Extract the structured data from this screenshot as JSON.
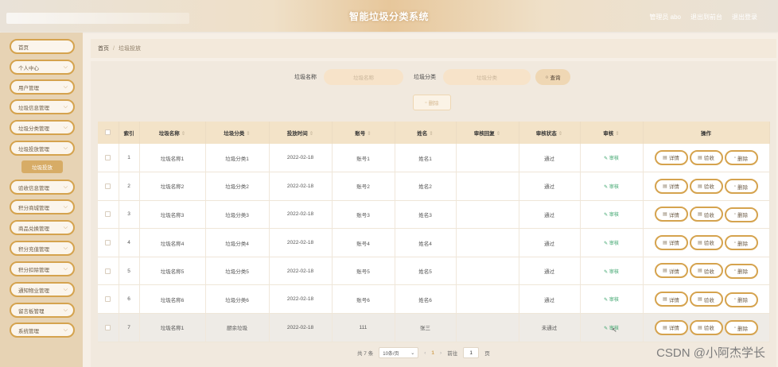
{
  "header": {
    "title": "智能垃圾分类系统",
    "admin_text": "管理员 abo",
    "back_label": "退出到前台",
    "logout_label": "退出登录"
  },
  "sidebar": {
    "items": [
      {
        "label": "首页",
        "has_chevron": false
      },
      {
        "label": "个人中心",
        "has_chevron": true
      },
      {
        "label": "用户管理",
        "has_chevron": true
      },
      {
        "label": "垃圾信息管理",
        "has_chevron": true
      },
      {
        "label": "垃圾分类管理",
        "has_chevron": true
      },
      {
        "label": "垃圾投放管理",
        "has_chevron": true
      },
      {
        "label": "验收信息管理",
        "has_chevron": true
      },
      {
        "label": "积分商城管理",
        "has_chevron": true
      },
      {
        "label": "商品兑换管理",
        "has_chevron": true
      },
      {
        "label": "积分充值管理",
        "has_chevron": true
      },
      {
        "label": "积分扣除管理",
        "has_chevron": true
      },
      {
        "label": "通知物业管理",
        "has_chevron": true
      },
      {
        "label": "留言板管理",
        "has_chevron": true
      },
      {
        "label": "系统管理",
        "has_chevron": true
      }
    ],
    "active_sub": "垃圾投放"
  },
  "breadcrumb": {
    "home": "首页",
    "separator": "/",
    "current": "垃圾投放"
  },
  "search": {
    "name_label": "垃圾名称",
    "name_placeholder": "垃圾名称",
    "category_label": "垃圾分类",
    "category_placeholder": "垃圾分类",
    "query_label": "查询"
  },
  "batch_delete_label": "删除",
  "table": {
    "headers": [
      "",
      "索引",
      "垃圾名称",
      "垃圾分类",
      "投放时间",
      "账号",
      "姓名",
      "审核回复",
      "审核状态",
      "审核",
      "操作"
    ],
    "sortable": [
      false,
      false,
      true,
      true,
      true,
      true,
      true,
      true,
      true,
      true,
      false
    ],
    "audit_link_label": "审核",
    "op_labels": {
      "detail": "详情",
      "accept": "验收",
      "delete": "删除"
    },
    "rows": [
      {
        "index": "1",
        "name": "垃圾名称1",
        "category": "垃圾分类1",
        "time": "2022-02-18",
        "account": "账号1",
        "person": "姓名1",
        "reply": "",
        "status": "通过"
      },
      {
        "index": "2",
        "name": "垃圾名称2",
        "category": "垃圾分类2",
        "time": "2022-02-18",
        "account": "账号2",
        "person": "姓名2",
        "reply": "",
        "status": "通过"
      },
      {
        "index": "3",
        "name": "垃圾名称3",
        "category": "垃圾分类3",
        "time": "2022-02-18",
        "account": "账号3",
        "person": "姓名3",
        "reply": "",
        "status": "通过"
      },
      {
        "index": "4",
        "name": "垃圾名称4",
        "category": "垃圾分类4",
        "time": "2022-02-18",
        "account": "账号4",
        "person": "姓名4",
        "reply": "",
        "status": "通过"
      },
      {
        "index": "5",
        "name": "垃圾名称5",
        "category": "垃圾分类5",
        "time": "2022-02-18",
        "account": "账号5",
        "person": "姓名5",
        "reply": "",
        "status": "通过"
      },
      {
        "index": "6",
        "name": "垃圾名称6",
        "category": "垃圾分类6",
        "time": "2022-02-18",
        "account": "账号6",
        "person": "姓名6",
        "reply": "",
        "status": "通过"
      },
      {
        "index": "7",
        "name": "垃圾名称1",
        "category": "厨余垃圾",
        "time": "2022-02-18",
        "account": "111",
        "person": "张三",
        "reply": "",
        "status": "未通过"
      }
    ]
  },
  "pagination": {
    "total_text": "共 7 条",
    "page_size": "10条/页",
    "current_page": "1",
    "goto_label": "前往",
    "goto_value": "1",
    "page_suffix": "页"
  },
  "watermark": "CSDN @小阿杰学长",
  "colors": {
    "accent": "#d5a34e",
    "header_bg": "#e7c79b",
    "sidebar_bg": "#e7d3b4",
    "audit_link": "#39a36a"
  }
}
